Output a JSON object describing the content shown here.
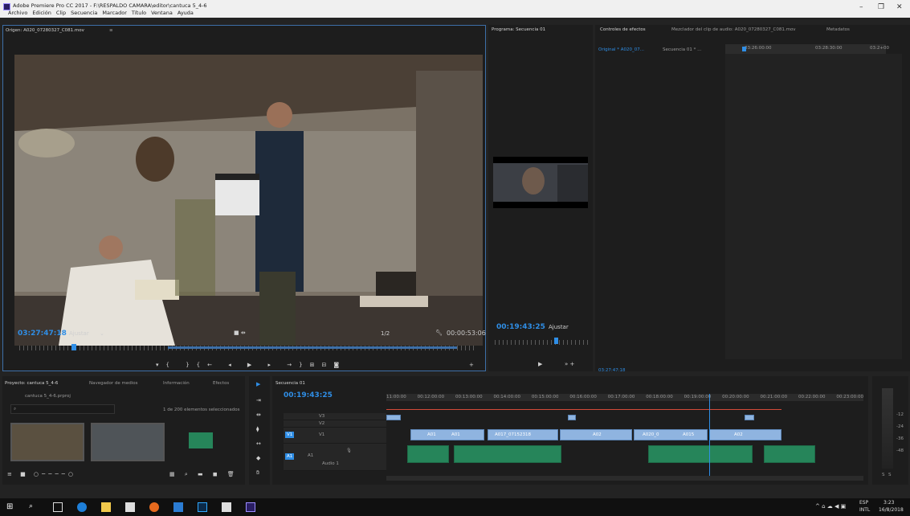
{
  "window": {
    "title": "Adobe Premiere Pro CC 2017 - F:\\RESPALDO CAMARA\\editor\\cantuca 5_4-6",
    "menu": [
      "Archivo",
      "Edición",
      "Clip",
      "Secuencia",
      "Marcador",
      "Título",
      "Ventana",
      "Ayuda"
    ]
  },
  "source_monitor": {
    "tab": "Origen: A020_07280327_C081.mov",
    "timecode": "03:27:47:18",
    "fit": "Ajustar",
    "resolution": "1/2",
    "duration": "00:00:53:06",
    "slate_text": "6 4 9 3"
  },
  "program_monitor": {
    "tab": "Programa: Secuencia 01",
    "timecode": "00:19:43:25",
    "fit": "Ajustar"
  },
  "effects_controls": {
    "tabs": [
      "Controles de efectos",
      "Mezclador del clip de audio: A020_07280327_C081.mov",
      "Metadatos"
    ],
    "source": "Original * A020_07...",
    "sequence": "Secuencia 01 * ...",
    "ruler": [
      "03:26:00:00",
      "03:28:30:00",
      "03:2+00"
    ],
    "timecode": "03:27:47:18"
  },
  "project": {
    "tabs": [
      "Proyecto: cantuca 5_4-6",
      "Navegador de medios",
      "Información",
      "Efectos"
    ],
    "file": "cantuca 5_4-6.prproj",
    "selection": "1 de 200 elementos seleccionados"
  },
  "timeline": {
    "tab": "Secuencia 01",
    "timecode": "00:19:43:25",
    "ruler": [
      "11:00:00",
      "00:12:00:00",
      "00:13:00:00",
      "00:14:00:00",
      "00:15:00:00",
      "00:16:00:00",
      "00:17:00:00",
      "00:18:00:00",
      "00:19:00:00",
      "00:20:00:00",
      "00:21:00:00",
      "00:22:00:00",
      "00:23:00:00",
      "00:"
    ],
    "tracks": [
      "V3",
      "V2",
      "V1",
      "A1"
    ],
    "track_labels": {
      "v1_src": "V1",
      "a1_src": "A1",
      "audio": "Audio 1"
    },
    "clip_labels": [
      "A01",
      "A01",
      "A017_07152318",
      "A02",
      "A020_0",
      "A015",
      "A02"
    ],
    "vu_labels": [
      "-12",
      "-24",
      "-36",
      "-48",
      "S",
      "S"
    ]
  },
  "taskbar": {
    "lang": "ESP",
    "layout": "INTL",
    "time": "3:23",
    "date": "16/8/2018"
  }
}
